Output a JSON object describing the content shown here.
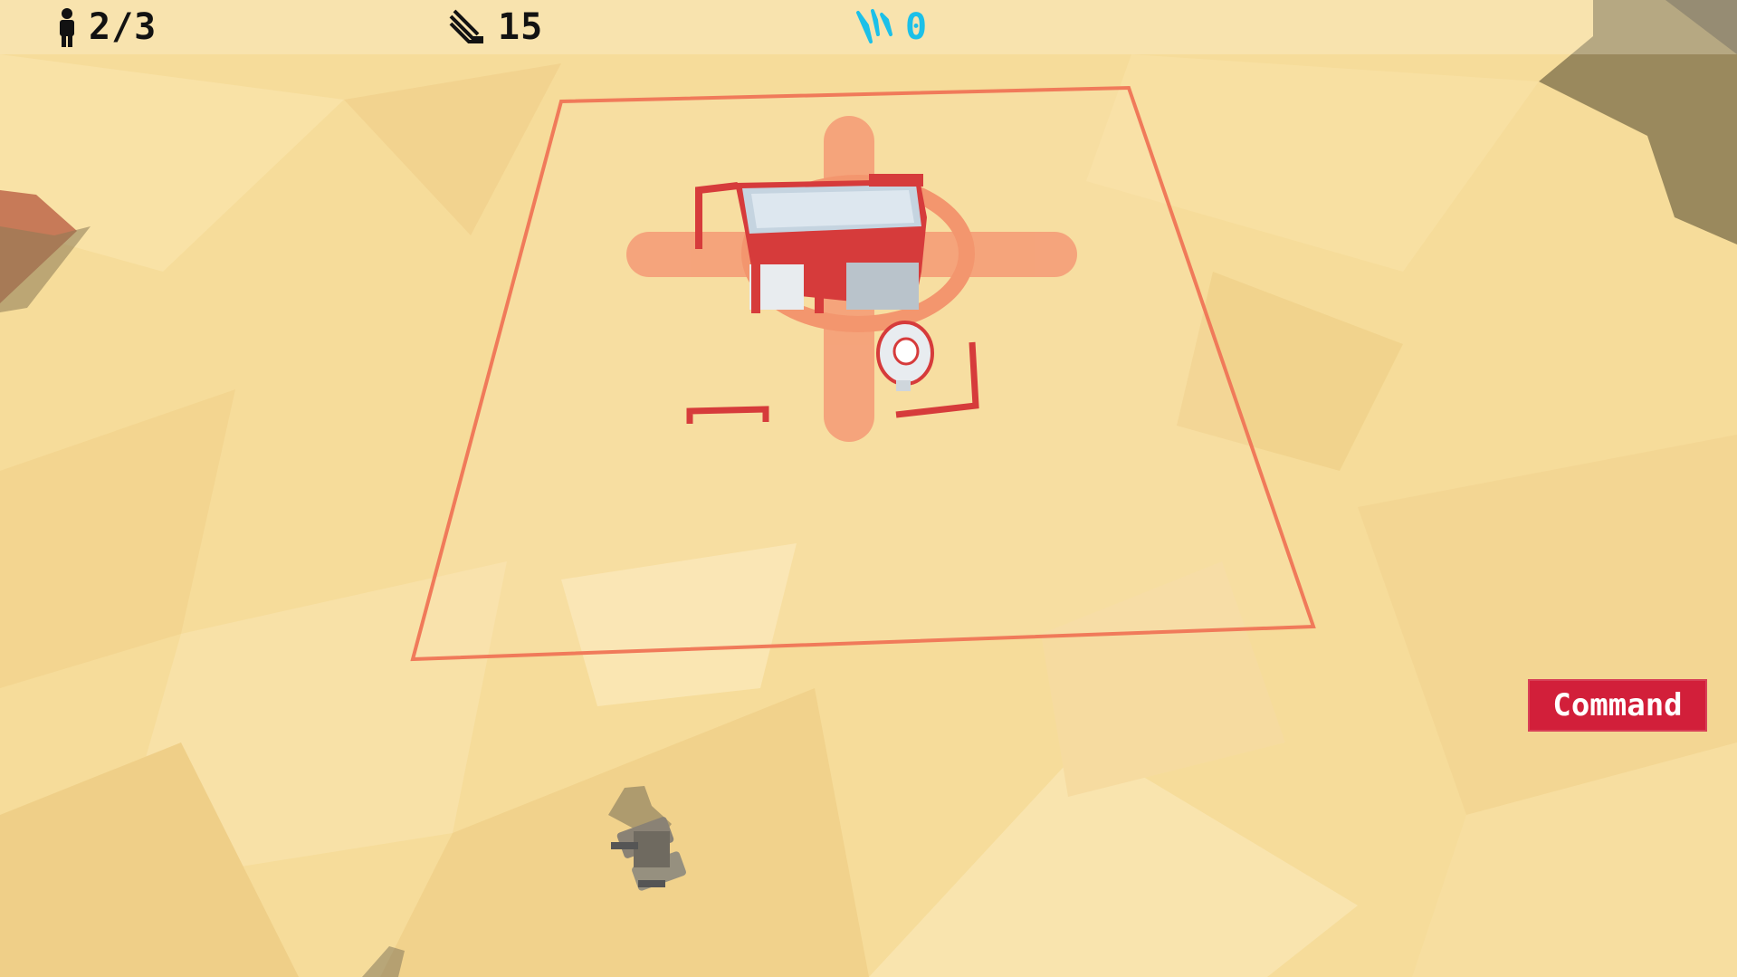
{
  "hud": {
    "population": {
      "icon": "person-icon",
      "value": "2/3"
    },
    "metal": {
      "icon": "metal-bars-icon",
      "value": "15"
    },
    "energy": {
      "icon": "energy-shards-icon",
      "value": "0",
      "color": "#1cc0e8"
    }
  },
  "actions": {
    "command_label": "Command",
    "command_color": "#d21f3a"
  },
  "scene": {
    "terrain": "desert-lowpoly",
    "ground_color": "#f6dc9a",
    "base_color": "#e03c3c",
    "build_zone_color": "#f07a5a"
  }
}
